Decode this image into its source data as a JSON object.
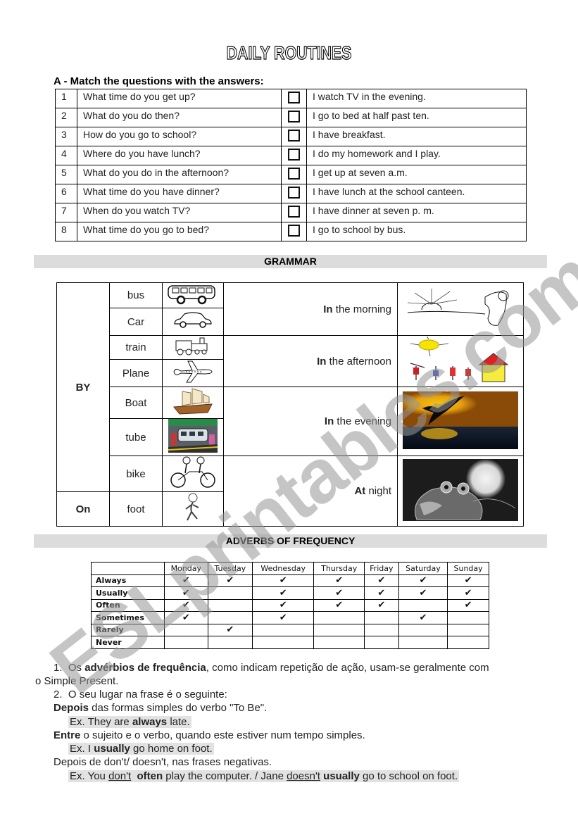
{
  "document": {
    "title": "DAILY ROUTINES",
    "section_a": {
      "heading": "A -  Match the questions with the answers:",
      "rows": [
        {
          "num": "1",
          "question": "What time do you get up?",
          "answer": "I watch TV in the evening."
        },
        {
          "num": "2",
          "question": "What do you do then?",
          "answer": "I go to bed at half past ten."
        },
        {
          "num": "3",
          "question": "How do you go to school?",
          "answer": "I have breakfast."
        },
        {
          "num": "4",
          "question": "Where do you have lunch?",
          "answer": "I do my homework and I play."
        },
        {
          "num": "5",
          "question": "What do you do in the afternoon?",
          "answer": "I get up at seven a.m."
        },
        {
          "num": "6",
          "question": "What time do you have dinner?",
          "answer": "I have lunch at the school canteen."
        },
        {
          "num": "7",
          "question": "When do you watch TV?",
          "answer": "I have dinner at seven p. m."
        },
        {
          "num": "8",
          "question": "What time do you go to bed?",
          "answer": "I go to school by bus."
        }
      ]
    },
    "grammar": {
      "heading": "GRAMMAR",
      "prep_by": "BY",
      "prep_on": "On",
      "transport": [
        {
          "label": "bus",
          "icon": "bus-icon"
        },
        {
          "label": "Car",
          "icon": "car-icon"
        },
        {
          "label": "train",
          "icon": "train-icon"
        },
        {
          "label": "Plane",
          "icon": "plane-icon"
        },
        {
          "label": "Boat",
          "icon": "boat-icon"
        },
        {
          "label": "tube",
          "icon": "tube-icon"
        },
        {
          "label": "bike",
          "icon": "bike-icon"
        },
        {
          "label": "foot",
          "icon": "walking-icon"
        }
      ],
      "times": [
        {
          "prep": "In",
          "rest": " the morning",
          "image": "sunrise-image"
        },
        {
          "prep": "In",
          "rest": " the afternoon",
          "image": "family-sun-image"
        },
        {
          "prep": "In",
          "rest": " the evening",
          "image": "bird-sunset-image"
        },
        {
          "prep": "At",
          "rest": " night",
          "image": "owl-moon-image"
        }
      ]
    },
    "adverbs": {
      "heading": "ADVERBS OF FREQUENCY",
      "days": [
        "Monday",
        "Tuesday",
        "Wednesday",
        "Thursday",
        "Friday",
        "Saturday",
        "Sunday"
      ],
      "tick_glyph": "✔",
      "rows": [
        {
          "label": "Always",
          "ticks": [
            true,
            true,
            true,
            true,
            true,
            true,
            true
          ]
        },
        {
          "label": "Usually",
          "ticks": [
            true,
            false,
            true,
            true,
            true,
            true,
            true
          ]
        },
        {
          "label": "Often",
          "ticks": [
            true,
            false,
            true,
            true,
            true,
            false,
            true
          ]
        },
        {
          "label": "Sometimes",
          "ticks": [
            true,
            false,
            true,
            false,
            false,
            true,
            false
          ]
        },
        {
          "label": "Rarely",
          "ticks": [
            false,
            true,
            false,
            false,
            false,
            false,
            false
          ]
        },
        {
          "label": "Never",
          "ticks": [
            false,
            false,
            false,
            false,
            false,
            false,
            false
          ]
        }
      ]
    },
    "notes": {
      "n1_num": "1.",
      "n1_pre": "Os ",
      "n1_bold": "advérbios de frequência",
      "n1_post": ", como indicam repetição de ação, usam-se geralmente com",
      "n1_cont": "o Simple Present.",
      "n2_num": "2.",
      "n2_text": "O seu lugar na frase é o seguinte:",
      "rule1_bold": "Depois",
      "rule1_text": " das formas simples do verbo \"To Be\".",
      "ex1_pre": "Ex. They are ",
      "ex1_bold": "always",
      "ex1_post": " late.",
      "rule2_bold": "Entre",
      "rule2_text": " o sujeito e o verbo, quando este estiver num tempo simples.",
      "ex2_pre": "Ex. I ",
      "ex2_bold": "usually",
      "ex2_post": " go home on foot.",
      "rule3_text": "Depois de don't/ doesn't, nas frases negativas.",
      "ex3_a": "Ex. You ",
      "ex3_u1": "don't",
      "ex3_b": "  ",
      "ex3_bold1": "often",
      "ex3_c": " play the computer. / Jane ",
      "ex3_u2": "doesn't",
      "ex3_d": " ",
      "ex3_bold2": "usually",
      "ex3_e": " go to school on foot."
    },
    "watermark": "ESLprintables.com"
  }
}
